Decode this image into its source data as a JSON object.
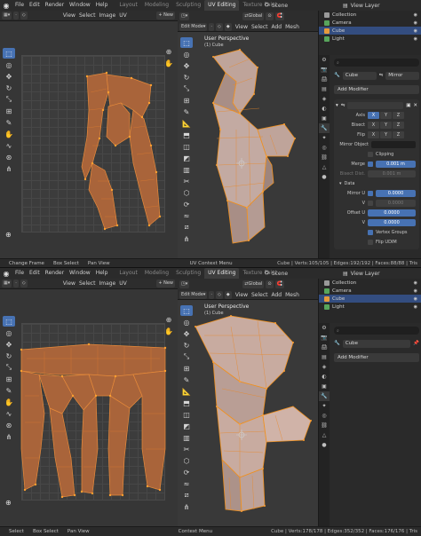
{
  "menu": [
    "File",
    "Edit",
    "Render",
    "Window",
    "Help"
  ],
  "workspaces": [
    "Layout",
    "Modeling",
    "Sculpting",
    "UV Editing",
    "Texture Paint"
  ],
  "active_workspace": "UV Editing",
  "scene": "Scene",
  "view_layer": "View Layer",
  "uv_header": {
    "menus": [
      "View",
      "Select",
      "Image",
      "UV"
    ],
    "new_label": "+ New"
  },
  "vp_header": {
    "mode": "Edit Mode",
    "menus": [
      "View",
      "Select",
      "Add",
      "Mesh"
    ],
    "orientation": "Global"
  },
  "outliner": {
    "top": [
      {
        "name": "Collection",
        "color": "#9a9a9a",
        "selected": false
      },
      {
        "name": "Camera",
        "color": "#58a55c",
        "selected": false
      },
      {
        "name": "Cube",
        "color": "#e69a3c",
        "selected": true
      },
      {
        "name": "Light",
        "color": "#58a55c",
        "selected": false
      }
    ]
  },
  "panels": [
    {
      "viewport_title": "User Perspective",
      "viewport_sub": "(1) Cube",
      "object_name": "Cube",
      "mirror_name": "Mirror",
      "add_modifier": "Add Modifier",
      "status_items": [
        "Change Frame",
        "Box Select",
        "Pan View"
      ],
      "status_mid": "UV Context Menu",
      "stats": "Cube | Verts:105/105 | Edges:192/192 | Faces:88/88 | Tris"
    },
    {
      "viewport_title": "User Perspective",
      "viewport_sub": "(1) Cube",
      "object_name": "Cube",
      "add_modifier": "Add Modifier",
      "status_items": [
        "Select",
        "Box Select",
        "Pan View"
      ],
      "status_mid": "Context Menu",
      "stats": "Cube | Verts:178/178 | Edges:352/352 | Faces:176/176 | Tris"
    }
  ],
  "modifier": {
    "axis_label": "Axis",
    "bisect_label": "Bisect",
    "flip_label": "Flip",
    "axes": [
      "X",
      "Y",
      "Z"
    ],
    "mirror_object_label": "Mirror Object",
    "clipping_label": "Clipping",
    "merge_label": "Merge",
    "merge_value": "0.001 m",
    "bisect_dist_label": "Bisect Dist.",
    "bisect_dist_value": "0.001 m",
    "data_label": "Data",
    "mirror_u_label": "Mirror U",
    "mirror_u_value": "0.0000",
    "v_label": "V",
    "v_value": "0.0000",
    "offset_u_label": "Offset U",
    "offset_u_value": "0.0000",
    "offset_v_value": "0.0000",
    "vertex_groups_label": "Vertex Groups",
    "flip_udim_label": "Flip UDIM"
  },
  "colors": {
    "accent": "#4772b3",
    "selected": "#e69a3c",
    "uv_face": "#b86a36"
  }
}
